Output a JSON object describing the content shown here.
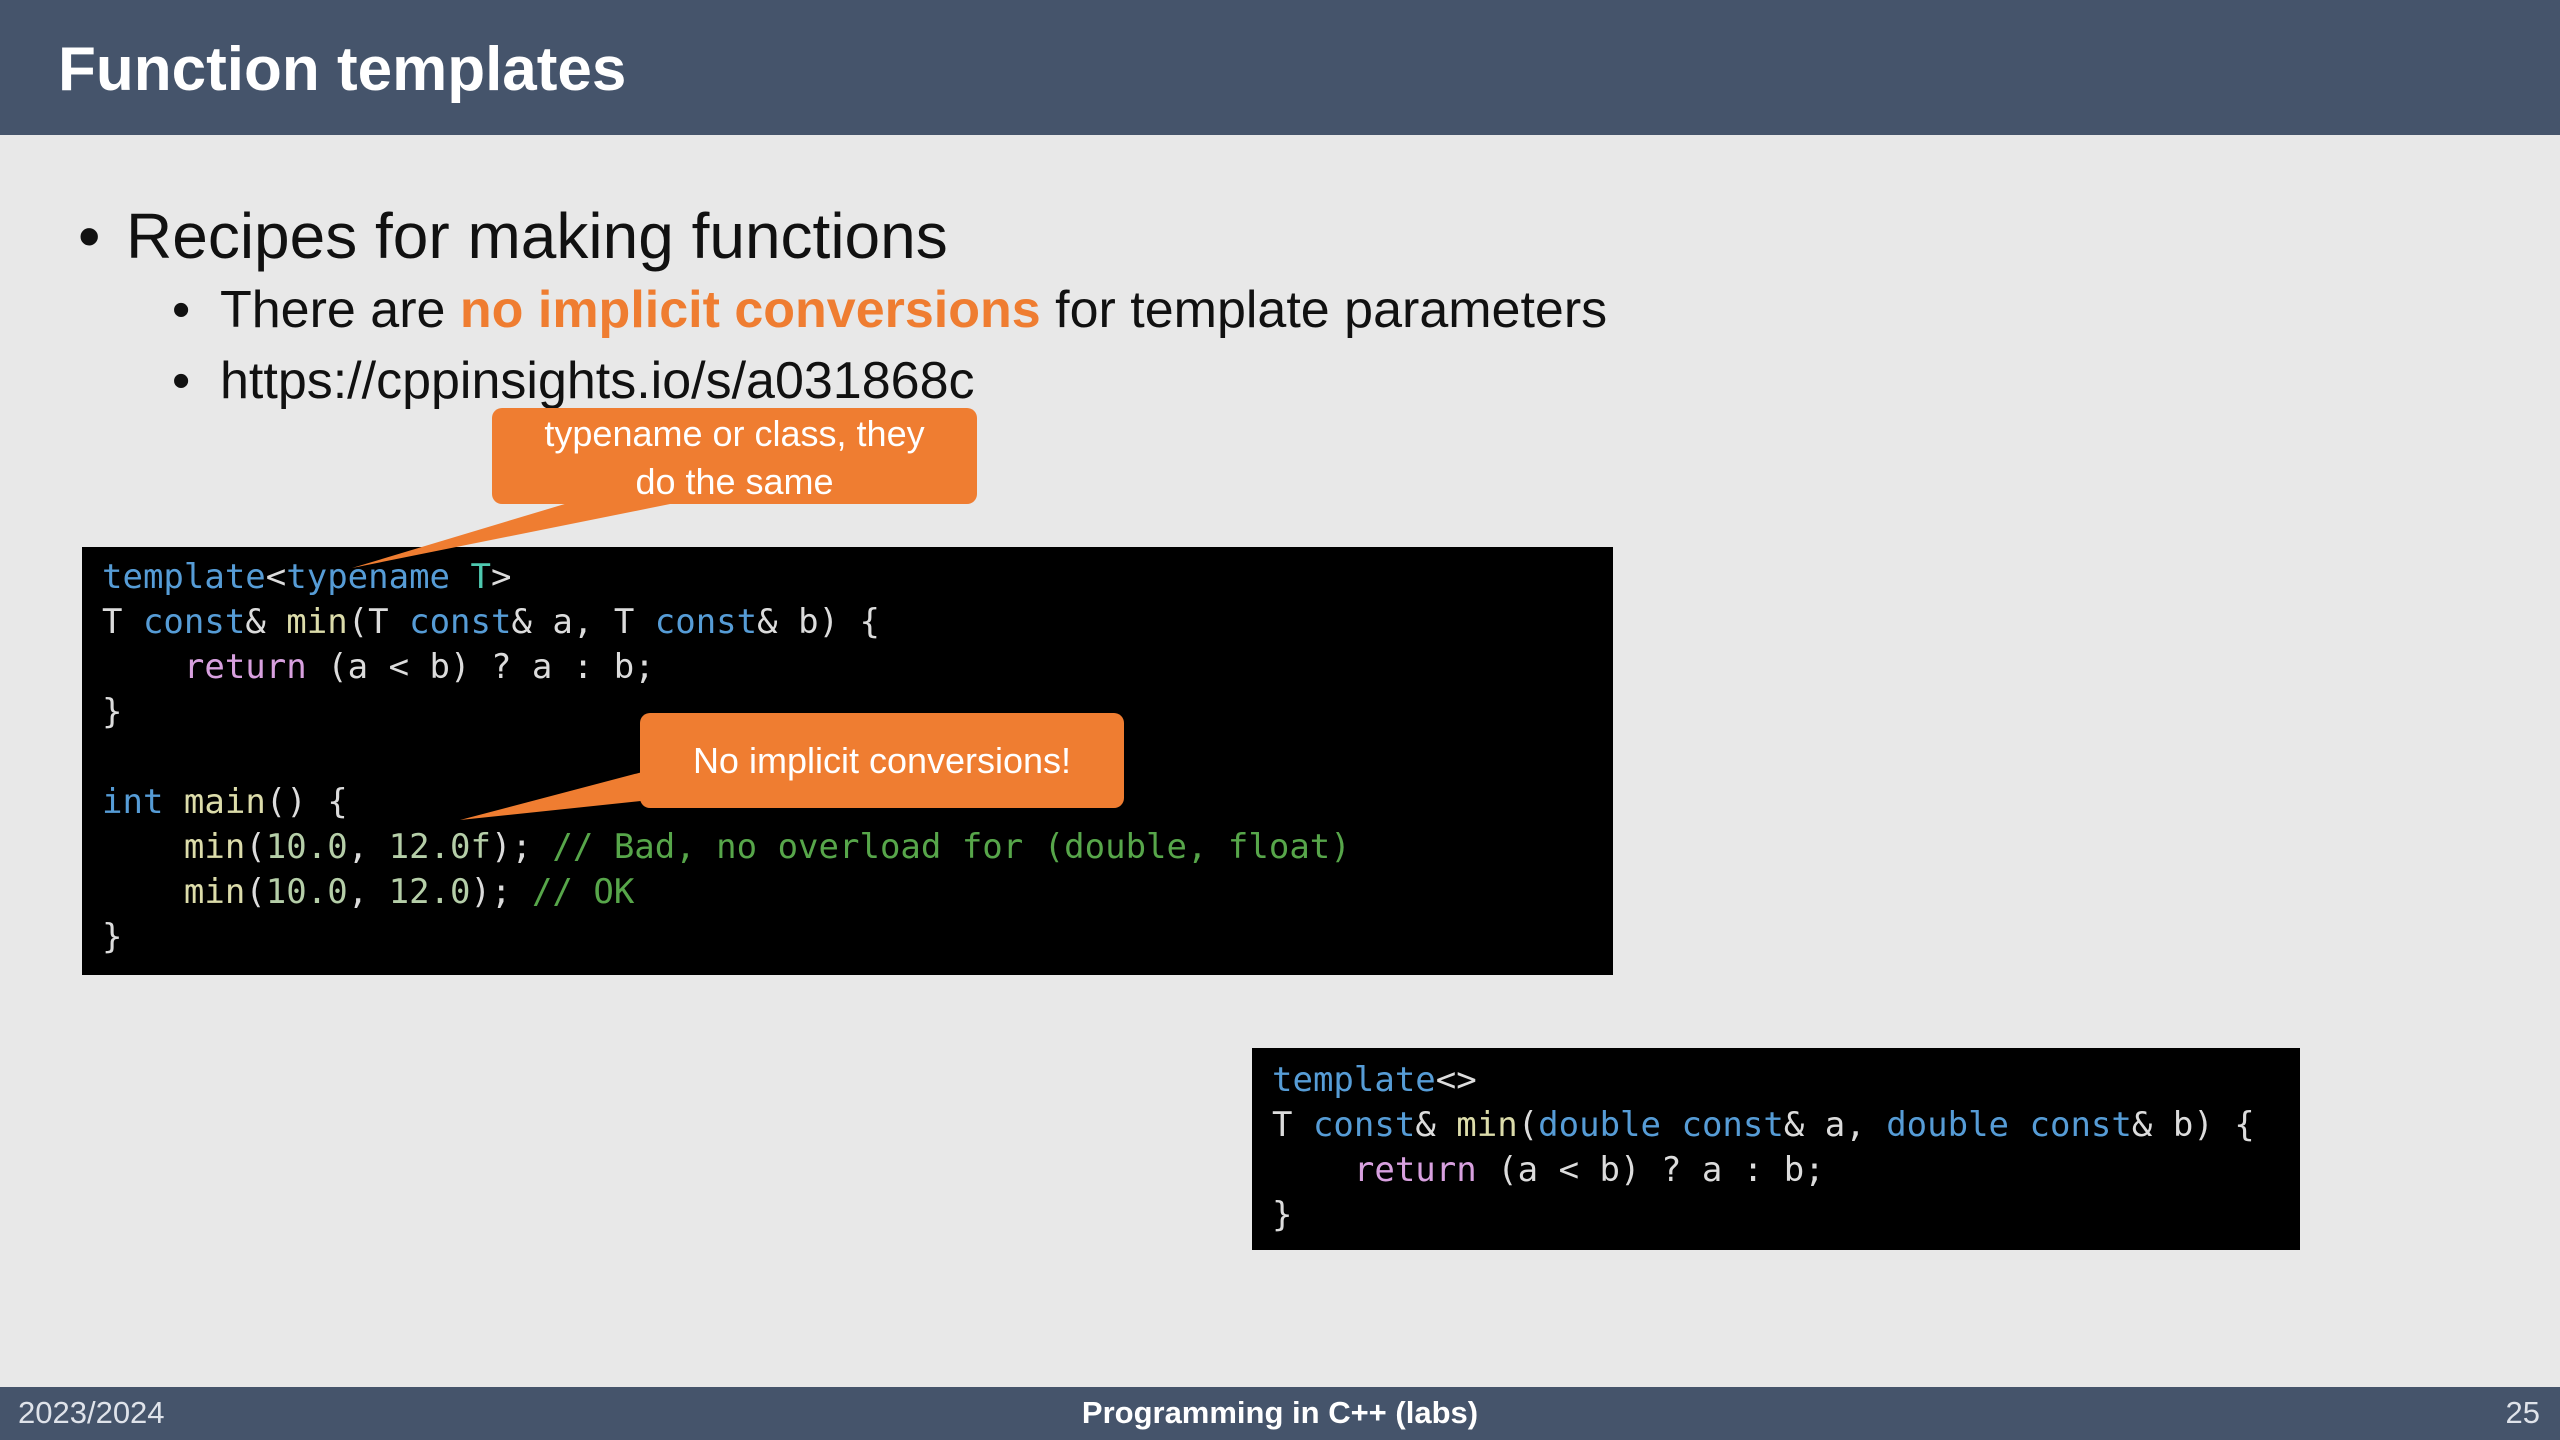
{
  "slide": {
    "title": "Function templates",
    "bullet1": "Recipes for making functions",
    "bullet2_pre": "There are ",
    "bullet2_highlight": "no implicit conversions",
    "bullet2_post": " for template parameters",
    "bullet3": "https://cppinsights.io/s/a031868c",
    "bullet_glyph": "•"
  },
  "callouts": {
    "c1_line1": "typename or class, they",
    "c1_line2": "do the same",
    "c2": "No implicit conversions!"
  },
  "code1": [
    [
      {
        "t": "template",
        "c": "kw"
      },
      {
        "t": "<",
        "c": ""
      },
      {
        "t": "typename",
        "c": "kw"
      },
      {
        "t": " ",
        "c": ""
      },
      {
        "t": "T",
        "c": "tp"
      },
      {
        "t": ">",
        "c": ""
      }
    ],
    [
      {
        "t": "T ",
        "c": ""
      },
      {
        "t": "const",
        "c": "kw"
      },
      {
        "t": "& ",
        "c": ""
      },
      {
        "t": "min",
        "c": "fn"
      },
      {
        "t": "(T ",
        "c": ""
      },
      {
        "t": "const",
        "c": "kw"
      },
      {
        "t": "& a, T ",
        "c": ""
      },
      {
        "t": "const",
        "c": "kw"
      },
      {
        "t": "& b) {",
        "c": ""
      }
    ],
    [
      {
        "t": "    ",
        "c": ""
      },
      {
        "t": "return",
        "c": "ctl"
      },
      {
        "t": " (a < b) ? a : b;",
        "c": ""
      }
    ],
    [
      {
        "t": "}",
        "c": ""
      }
    ],
    [
      {
        "t": "",
        "c": ""
      }
    ],
    [
      {
        "t": "int",
        "c": "kw"
      },
      {
        "t": " ",
        "c": ""
      },
      {
        "t": "main",
        "c": "fn"
      },
      {
        "t": "() {",
        "c": ""
      }
    ],
    [
      {
        "t": "    ",
        "c": ""
      },
      {
        "t": "min",
        "c": "fn"
      },
      {
        "t": "(",
        "c": ""
      },
      {
        "t": "10.0",
        "c": "num"
      },
      {
        "t": ", ",
        "c": ""
      },
      {
        "t": "12.0f",
        "c": "num"
      },
      {
        "t": "); ",
        "c": ""
      },
      {
        "t": "// Bad, no overload for (double, float)",
        "c": "cm"
      }
    ],
    [
      {
        "t": "    ",
        "c": ""
      },
      {
        "t": "min",
        "c": "fn"
      },
      {
        "t": "(",
        "c": ""
      },
      {
        "t": "10.0",
        "c": "num"
      },
      {
        "t": ", ",
        "c": ""
      },
      {
        "t": "12.0",
        "c": "num"
      },
      {
        "t": "); ",
        "c": ""
      },
      {
        "t": "// OK",
        "c": "cm"
      }
    ],
    [
      {
        "t": "}",
        "c": ""
      }
    ]
  ],
  "code2": [
    [
      {
        "t": "template",
        "c": "kw"
      },
      {
        "t": "<>",
        "c": ""
      }
    ],
    [
      {
        "t": "T ",
        "c": ""
      },
      {
        "t": "const",
        "c": "kw"
      },
      {
        "t": "& ",
        "c": ""
      },
      {
        "t": "min",
        "c": "fn"
      },
      {
        "t": "(",
        "c": ""
      },
      {
        "t": "double",
        "c": "kw"
      },
      {
        "t": " ",
        "c": ""
      },
      {
        "t": "const",
        "c": "kw"
      },
      {
        "t": "& a, ",
        "c": ""
      },
      {
        "t": "double",
        "c": "kw"
      },
      {
        "t": " ",
        "c": ""
      },
      {
        "t": "const",
        "c": "kw"
      },
      {
        "t": "& b) {",
        "c": ""
      }
    ],
    [
      {
        "t": "    ",
        "c": ""
      },
      {
        "t": "return",
        "c": "ctl"
      },
      {
        "t": " (a < b) ? a : b;",
        "c": ""
      }
    ],
    [
      {
        "t": "}",
        "c": ""
      }
    ]
  ],
  "footer": {
    "left": "2023/2024",
    "center": "Programming in C++ (labs)",
    "right": "25"
  },
  "colors": {
    "header_bg": "#45546b",
    "slide_bg": "#e8e8e8",
    "accent": "#ef7d31",
    "code_bg": "#000000"
  }
}
